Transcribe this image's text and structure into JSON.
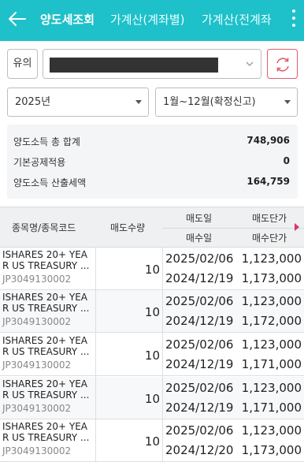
{
  "header": {
    "tabs": [
      "양도세조회",
      "가계산(계좌별)",
      "가계산(전계좌"
    ]
  },
  "filters": {
    "yuui_label": "유의",
    "year": "2025년",
    "period": "1월~12월(확정신고)"
  },
  "summary": [
    {
      "label": "양도소득 총 합계",
      "value": "748,906"
    },
    {
      "label": "기본공제적용",
      "value": "0"
    },
    {
      "label": "양도소득 산출세액",
      "value": "164,759"
    }
  ],
  "table": {
    "headers": {
      "name": "종목명/종목코드",
      "qty": "매도수량",
      "sell_date": "매도일",
      "buy_date": "매수일",
      "sell_price": "매도단가",
      "buy_price": "매수단가"
    },
    "rows": [
      {
        "name1": "ISHARES 20+ YEA",
        "name2": "R US TREASURY ...",
        "code": "JP3049130002",
        "qty": "10",
        "sell_date": "2025/02/06",
        "buy_date": "2024/12/19",
        "sell_price": "1,123,000",
        "buy_price": "1,173,000"
      },
      {
        "name1": "ISHARES 20+ YEA",
        "name2": "R US TREASURY ...",
        "code": "JP3049130002",
        "qty": "10",
        "sell_date": "2025/02/06",
        "buy_date": "2024/12/19",
        "sell_price": "1,123,000",
        "buy_price": "1,172,000"
      },
      {
        "name1": "ISHARES 20+ YEA",
        "name2": "R US TREASURY ...",
        "code": "JP3049130002",
        "qty": "10",
        "sell_date": "2025/02/06",
        "buy_date": "2024/12/19",
        "sell_price": "1,123,000",
        "buy_price": "1,171,000"
      },
      {
        "name1": "ISHARES 20+ YEA",
        "name2": "R US TREASURY ...",
        "code": "JP3049130002",
        "qty": "10",
        "sell_date": "2025/02/06",
        "buy_date": "2024/12/19",
        "sell_price": "1,123,000",
        "buy_price": "1,171,000"
      },
      {
        "name1": "ISHARES 20+ YEA",
        "name2": "R US TREASURY ...",
        "code": "JP3049130002",
        "qty": "10",
        "sell_date": "2025/02/06",
        "buy_date": "2024/12/20",
        "sell_price": "1,123,000",
        "buy_price": "1,173,000"
      }
    ]
  },
  "colors": {
    "accent": "#1ec0c9",
    "refresh": "#e05a6f",
    "scroll_arrow": "#e0306a"
  },
  "icons": {
    "back": "back-arrow-icon",
    "more": "more-vertical-icon",
    "refresh": "refresh-icon",
    "dropdown": "chevron-down-icon"
  }
}
